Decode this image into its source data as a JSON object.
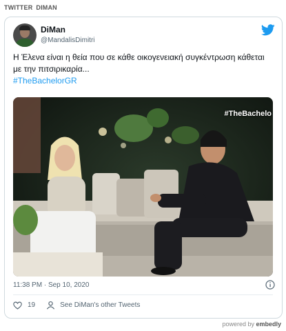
{
  "header": {
    "source": "TWITTER",
    "author": "DIMAN"
  },
  "tweet": {
    "name": "DiMan",
    "handle": "@MandalisDimitri",
    "text": "Η Έλενα είναι η θεία που σε κάθε οικογενειακή συγκέντρωση κάθεται με την πιτσιρικαρία...",
    "hashtag": "#TheBachelorGR",
    "media_overlay": "#TheBachelo",
    "timestamp": "11:38 PM · Sep 10, 2020",
    "likes": "19",
    "see_more": "See DiMan's other Tweets"
  },
  "footer": {
    "prefix": "powered by",
    "brand": "embedly"
  },
  "colors": {
    "accent": "#1d9bf0",
    "text": "#0f1419",
    "muted": "#536471",
    "border": "#cfd9de"
  },
  "icons": [
    "twitter-bird-icon",
    "info-icon",
    "heart-icon",
    "person-icon"
  ]
}
